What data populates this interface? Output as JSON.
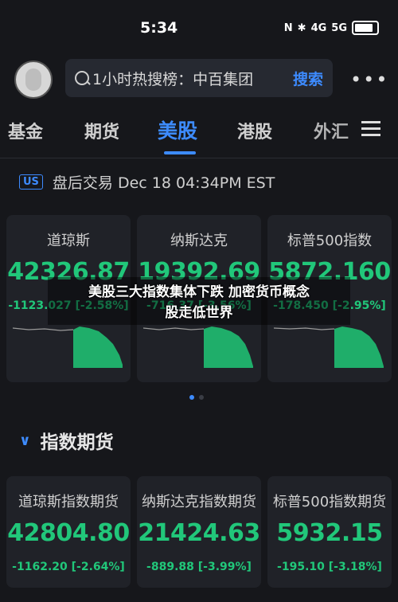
{
  "status": {
    "time": "5:34",
    "indicators": [
      "N",
      "✱",
      "4G",
      "5G"
    ]
  },
  "header": {
    "search_text": "1小时热搜榜：中百集团",
    "search_button": "搜索",
    "more": "•••"
  },
  "tabs": [
    {
      "label": "基金"
    },
    {
      "label": "期货"
    },
    {
      "label": "美股"
    },
    {
      "label": "港股"
    },
    {
      "label": "外汇"
    }
  ],
  "market": {
    "badge": "US",
    "text": "盘后交易 Dec 18 04:34PM EST"
  },
  "indices": [
    {
      "name": "道琼斯",
      "value": "42326.87",
      "change": "-1123.027 [-2.58%]"
    },
    {
      "name": "纳斯达克",
      "value": "19392.69",
      "change": "-716.37 [-3.56%]"
    },
    {
      "name": "标普500指数",
      "value": "5872.160",
      "change": "-178.450 [-2.95%]"
    }
  ],
  "overlay": {
    "line1": "美股三大指数集体下跌 加密货币概念",
    "line2": "股走低世界"
  },
  "section": {
    "title": "指数期货"
  },
  "futures": [
    {
      "name": "道琼斯指数期货",
      "value": "42804.80",
      "change": "-1162.20 [-2.64%]"
    },
    {
      "name": "纳斯达克指数期货",
      "value": "21424.63",
      "change": "-889.88 [-3.99%]"
    },
    {
      "name": "标普500指数期货",
      "value": "5932.15",
      "change": "-195.10 [-3.18%]"
    }
  ],
  "colors": {
    "accent": "#3d8bff",
    "down": "#21c77a",
    "background": "#16171b",
    "card": "#202228"
  }
}
